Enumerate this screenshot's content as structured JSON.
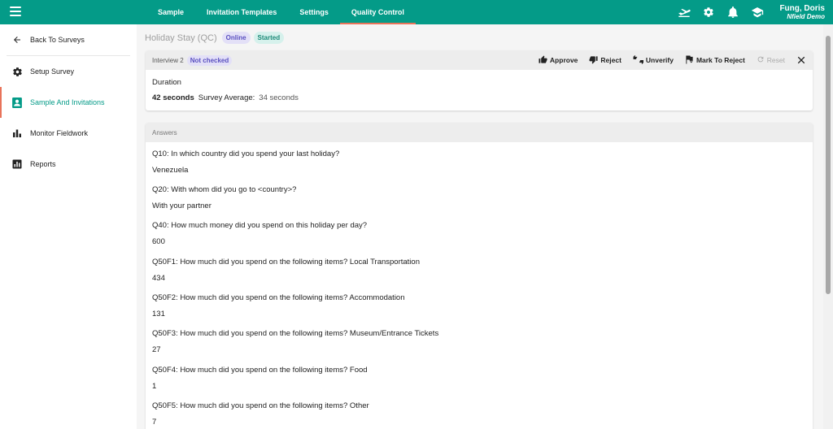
{
  "topbar": {
    "nav": [
      "Sample",
      "Invitation Templates",
      "Settings",
      "Quality Control"
    ],
    "active_nav": "Quality Control",
    "icons": [
      "plane-icon",
      "gear-icon",
      "bell-icon",
      "graduation-cap-icon"
    ],
    "user_name": "Fung, Doris",
    "user_org": "Nfield Demo",
    "accent_color": "#049b88"
  },
  "sidebar": {
    "items": [
      {
        "label": "Back To Surveys",
        "icon": "arrow-left-icon"
      },
      {
        "label": "Setup Survey",
        "icon": "gear-icon"
      },
      {
        "label": "Sample And Invitations",
        "icon": "contact-card-icon"
      },
      {
        "label": "Monitor Fieldwork",
        "icon": "bar-chart-icon"
      },
      {
        "label": "Reports",
        "icon": "report-icon"
      }
    ],
    "active": "Sample And Invitations"
  },
  "survey": {
    "title": "Holiday Stay (QC)",
    "chip_online": "Online",
    "chip_started": "Started"
  },
  "interview": {
    "label": "Interview 2",
    "status": "Not checked",
    "actions": {
      "approve": "Approve",
      "reject": "Reject",
      "unverify": "Unverify",
      "mark_reject": "Mark To Reject",
      "reset": "Reset"
    },
    "duration_label": "Duration",
    "duration_value": "42 seconds",
    "survey_avg_label": "Survey Average:",
    "survey_avg_value": "34 seconds"
  },
  "answers": {
    "label": "Answers",
    "items": [
      {
        "q": "Q10: In which country did you spend your last holiday?",
        "a": "Venezuela"
      },
      {
        "q": "Q20: With whom did you go to <country>?",
        "a": "With your partner"
      },
      {
        "q": "Q40: How much money did you spend on this holiday per day?",
        "a": "600"
      },
      {
        "q": "Q50F1: How much did you spend on the following items? Local Transportation",
        "a": "434"
      },
      {
        "q": "Q50F2: How much did you spend on the following items? Accommodation",
        "a": "131"
      },
      {
        "q": "Q50F3: How much did you spend on the following items? Museum/Entrance Tickets",
        "a": "27"
      },
      {
        "q": "Q50F4: How much did you spend on the following items? Food",
        "a": "1"
      },
      {
        "q": "Q50F5: How much did you spend on the following items? Other",
        "a": "7"
      }
    ]
  }
}
